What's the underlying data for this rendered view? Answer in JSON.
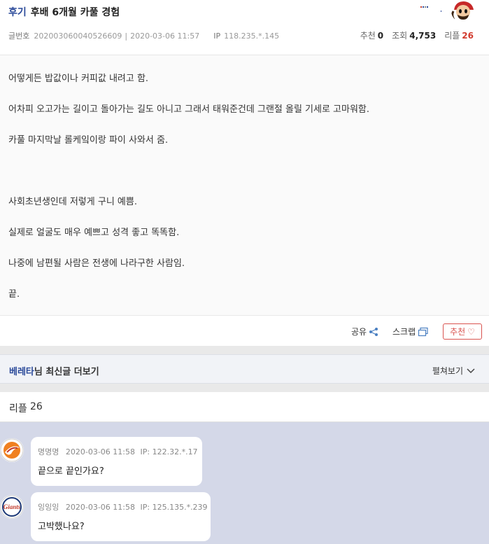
{
  "post": {
    "category": "후기",
    "title": "후배 6개월 카풀 경험",
    "meta": {
      "article_no_label": "글번호",
      "article_no": "20200306004052660​9",
      "date": "2020-03-06 11:57",
      "ip_label": "IP",
      "ip": "118.235.*.145"
    },
    "stats": {
      "recommend_label": "추천",
      "recommend": "0",
      "views_label": "조회",
      "views": "4,753",
      "replies_label": "리플",
      "replies": "26"
    },
    "body_lines": [
      "어떻게든 밥값이나 커피값 내려고 함.",
      "어차피 오고가는 길이고 돌아가는 길도 아니고 그래서 태워준건데 그랜절 올릴 기세로 고마워함.",
      "카풀 마지막날 롤케잌이랑 파이 사와서 줌.",
      "사회초년생인데 저렇게 구니 예쁨.",
      "실제로 얼굴도 매우 예쁘고 성격 좋고 똑똑함.",
      "나중에 남편될 사람은 전생에 나라구한 사람임.",
      "끝."
    ]
  },
  "actions": {
    "share_label": "공유",
    "scrap_label": "스크랩",
    "recommend_label": "추천"
  },
  "more": {
    "nickname": "베레타",
    "suffix": "님 최신글 더보기",
    "expand_label": "펼쳐보기"
  },
  "replies": {
    "label": "리플",
    "count": "26",
    "items": [
      {
        "nickname": "명명명",
        "date": "2020-03-06 11:58",
        "ip": "IP: 122.32.*.17",
        "text": "끝으로 끝인가요?",
        "avatar_icon": "eagles-logo-icon"
      },
      {
        "nickname": "잉잉잉",
        "date": "2020-03-06 11:58",
        "ip": "IP: 125.135.*.239",
        "text": "고박했나요?",
        "avatar_icon": "giants-logo-icon"
      }
    ]
  },
  "colors": {
    "brand_blue": "#2b4a9a",
    "accent_red": "#d23b2e",
    "reply_bg": "#d4d8e8"
  }
}
